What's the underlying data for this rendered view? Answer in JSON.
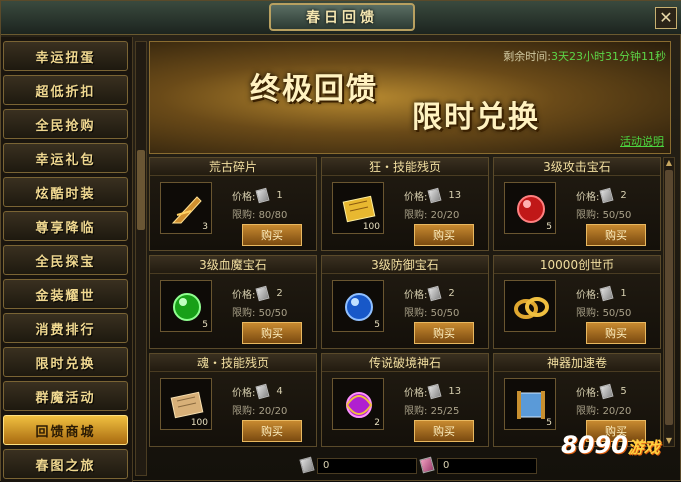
{
  "window": {
    "title": "春日回馈",
    "close_label": "✕"
  },
  "sidebar": {
    "items": [
      {
        "label": "幸运扭蛋",
        "active": false
      },
      {
        "label": "超低折扣",
        "active": false
      },
      {
        "label": "全民抢购",
        "active": false
      },
      {
        "label": "幸运礼包",
        "active": false
      },
      {
        "label": "炫酷时装",
        "active": false
      },
      {
        "label": "尊享降临",
        "active": false
      },
      {
        "label": "全民探宝",
        "active": false
      },
      {
        "label": "金装耀世",
        "active": false
      },
      {
        "label": "消费排行",
        "active": false
      },
      {
        "label": "限时兑换",
        "active": false
      },
      {
        "label": "群魔活动",
        "active": false
      },
      {
        "label": "回馈商城",
        "active": true
      },
      {
        "label": "春图之旅",
        "active": false
      }
    ]
  },
  "banner": {
    "title_left": "终极回馈",
    "title_right": "限时兑换",
    "remain_label": "剩余时间:",
    "remain_value": "3天23小时31分钟11秒",
    "rules_link": "活动说明"
  },
  "labels": {
    "price": "价格:",
    "limit": "限购:",
    "buy": "购买"
  },
  "items": [
    {
      "name": "荒古碎片",
      "price": "1",
      "limit": "80/80",
      "qty": "3",
      "icon": "shard-icon"
    },
    {
      "name": "狂・技能残页",
      "price": "13",
      "limit": "20/20",
      "qty": "100",
      "icon": "gold-scroll-icon"
    },
    {
      "name": "3级攻击宝石",
      "price": "2",
      "limit": "50/50",
      "qty": "5",
      "icon": "red-gem-icon"
    },
    {
      "name": "3级血魔宝石",
      "price": "2",
      "limit": "50/50",
      "qty": "5",
      "icon": "green-gem-icon"
    },
    {
      "name": "3级防御宝石",
      "price": "2",
      "limit": "50/50",
      "qty": "5",
      "icon": "blue-gem-icon"
    },
    {
      "name": "10000创世币",
      "price": "1",
      "limit": "50/50",
      "qty": "",
      "icon": "coin-rings-icon"
    },
    {
      "name": "魂・技能残页",
      "price": "4",
      "limit": "20/20",
      "qty": "100",
      "icon": "tan-scroll-icon"
    },
    {
      "name": "传说破境神石",
      "price": "13",
      "limit": "25/25",
      "qty": "2",
      "icon": "purple-stone-icon"
    },
    {
      "name": "神器加速卷",
      "price": "5",
      "limit": "20/20",
      "qty": "5",
      "icon": "map-scroll-icon"
    }
  ],
  "footer": {
    "silver_coupons": "0",
    "pink_coupons": "0"
  },
  "watermark": {
    "text": "8090",
    "sub": "游戏"
  },
  "colors": {
    "accent_gold": "#f0c040",
    "timer_green": "#5cd648",
    "border": "#5a4a2a"
  }
}
